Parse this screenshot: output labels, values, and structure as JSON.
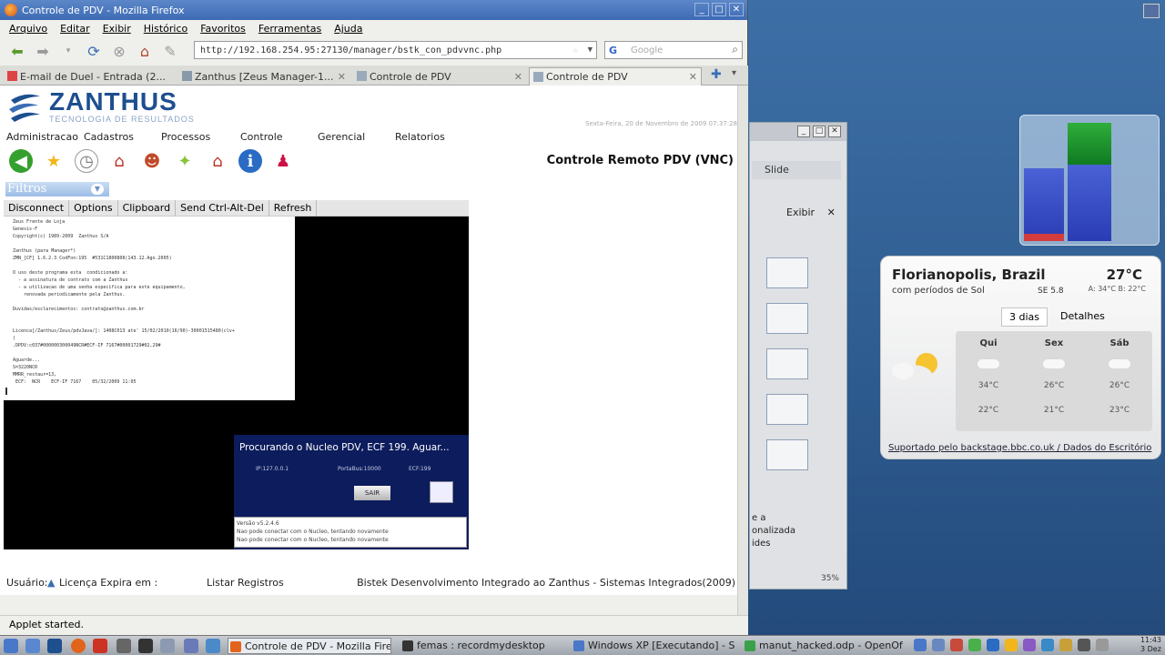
{
  "firefox": {
    "title": "Controle de PDV - Mozilla Firefox",
    "menu": [
      "Arquivo",
      "Editar",
      "Exibir",
      "Histórico",
      "Favoritos",
      "Ferramentas",
      "Ajuda"
    ],
    "url": "http://192.168.254.95:27130/manager/bstk_con_pdvvnc.php",
    "search_placeholder": "Google",
    "tabs": [
      {
        "label": "E-mail de Duel - Entrada (2...",
        "active": false
      },
      {
        "label": "Zanthus [Zeus Manager-1...",
        "active": false
      },
      {
        "label": "Controle de PDV",
        "active": false
      },
      {
        "label": "Controle de PDV",
        "active": true
      }
    ],
    "status": "Applet started."
  },
  "page": {
    "logo_big": "ZANTHUS",
    "logo_small": "TECNOLOGIA DE RESULTADOS",
    "date": "Sexta-Feira, 20 de Novembro de 2009 07:37:28",
    "menu": [
      "Administracao",
      "Cadastros",
      "Processos",
      "Controle",
      "Gerencial",
      "Relatorios"
    ],
    "title": "Controle Remoto PDV (VNC)",
    "filtros": "Filtros",
    "vnc_buttons": [
      "Disconnect",
      "Options",
      "Clipboard",
      "Send Ctrl-Alt-Del",
      "Refresh"
    ],
    "terminal_lines": [
      "Zeus Frente de Loja",
      "Genesis-F",
      "Copyright(c) 1989-2009  Zanthus S/A",
      "",
      "Zanthus (para Manager*)",
      "ZMN_[CF] 1.6.2.3 CodFon:195  #531C1800808(143.12.Ago.2005)",
      "",
      "O uso deste programa esta  condicionado a:",
      "  - a assinatura de contrato com a Zanthus",
      "  - a utilizacao de uma senha especifica para este equipamento,",
      "    renovada periodicamente pela Zanthus.",
      "",
      "Duvidas/esclarecimentos: contrato@zanthus.com.br",
      "",
      "",
      "Licenca[/Zanthus/Zeus/pdvJava/]: 1408C013 ate' 15/02/2010(16/90)-30001515480(clv+",
      ")",
      ".DPDV:c037#000000300049NCR#ECF-IF 7167#00001729#02,29#",
      "",
      "Aguarde...",
      "S=3220NCR",
      "MMRR_restaur=13,",
      " ECF:  NCR    ECF-IF 7167    05/32/2009 11:05"
    ],
    "dialog": {
      "title": "Procurando o Nucleo PDV, ECF 199. Aguar...",
      "ip": "IP:127.0.0.1",
      "porta": "PortaBus:10000",
      "ecf": "ECF:199",
      "sair": "SAIR",
      "log": [
        "Versão v5.2.4.6",
        "Nao pode conectar com o Nucleo, tentando novamente",
        "Nao pode conectar com o Nucleo, tentando novamente"
      ]
    },
    "usuario": "Usuário:",
    "licenca": "Licença Expira em :",
    "listar": "Listar Registros",
    "footer": "Bistek Desenvolvimento Integrado ao Zanthus - Sistemas Integrados(2009)"
  },
  "ooffice": {
    "slide": "Slide",
    "exibir": "Exibir",
    "bottom": [
      "e a",
      "onalizada",
      "ides"
    ],
    "zoom": "35%"
  },
  "weather": {
    "city": "Florianopolis, Brazil",
    "temp": "27°C",
    "condition": "com períodos de Sol",
    "wind": "SE 5.8",
    "hilo": "A: 34°C B: 22°C",
    "tabs": [
      "3 dias",
      "Detalhes"
    ],
    "forecast": [
      {
        "day": "Qui",
        "hi": "34°C",
        "lo": "22°C"
      },
      {
        "day": "Sex",
        "hi": "26°C",
        "lo": "21°C"
      },
      {
        "day": "Sáb",
        "hi": "26°C",
        "lo": "23°C"
      }
    ],
    "credit": "Suportado pelo backstage.bbc.co.uk / Dados do Escritório"
  },
  "taskbar": {
    "tasks": [
      {
        "label": "Controle de PDV - Mozilla Firefox",
        "active": true
      },
      {
        "label": "femas : recordmydesktop",
        "active": false
      },
      {
        "label": "Windows XP [Executando] - Su",
        "active": false
      },
      {
        "label": "manut_hacked.odp - OpenOf",
        "active": false
      }
    ],
    "time": "11:43",
    "date": "3 Dez"
  }
}
